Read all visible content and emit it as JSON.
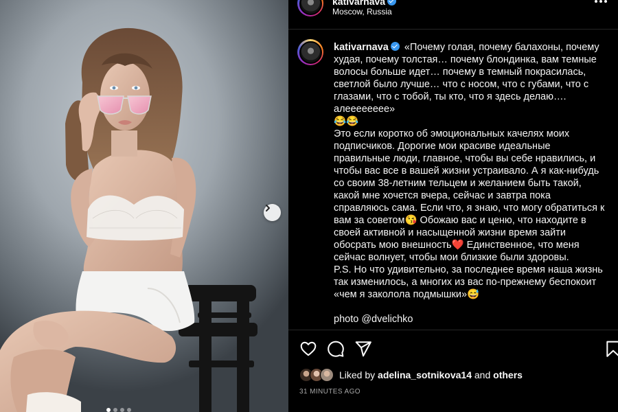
{
  "post": {
    "username": "kativarnava",
    "location": "Moscow, Russia",
    "caption_lines": [
      "«Почему голая, почему балахоны, почему",
      "худая, почему толстая… почему блондинка, вам темные",
      "волосы больше идет… почему в темный покрасилась,",
      "светлой было лучше… что с носом, что с губами, что с",
      "глазами, что с тобой, ты кто, что я здесь делаю….",
      "алееееееее»",
      "😂😂",
      "Это если коротко об эмоциональных качелях моих",
      "подписчиков. Дорогие мои красиве идеальные",
      "правильные люди, главное, чтобы вы себе нравились, и",
      "чтобы вас все в вашей жизни устраивало. А я как-нибудь",
      "со своим 38-летним тельцем и желанием быть такой,",
      "какой мне хочется вчера, сейчас и завтра пока",
      "справляюсь сама. Если что, я знаю, что могу обратиться к",
      "вам за советом😘 Обожаю вас и ценю, что находите в",
      "своей активной и насыщенной жизни время зайти",
      "обосрать мою внешность❤️ Единственное, что меня",
      "сейчас волнует, чтобы мои близкие были здоровы.",
      "P.S. Но что удивительно, за последнее время наша жизнь",
      "так изменилось, а многих из вас по-прежнему беспокоит",
      "«чем я заколола подмышки»😅",
      "",
      "photo @dvelichko"
    ],
    "liked_prefix": "Liked by",
    "liked_user": "adelina_sotnikova14",
    "liked_conj": "and",
    "liked_others": "others",
    "timestamp": "31 MINUTES AGO",
    "carousel": {
      "count": 4,
      "active": 1
    }
  },
  "icons": {
    "verified": "verified-badge-icon",
    "more": "more-options-icon",
    "like": "heart-icon",
    "comment": "comment-icon",
    "share": "send-icon",
    "save": "bookmark-icon",
    "next": "chevron-right-icon"
  },
  "colors": {
    "background": "#000000",
    "verified": "#3897f0",
    "divider": "#262626",
    "muted_text": "#a8a8a8"
  }
}
